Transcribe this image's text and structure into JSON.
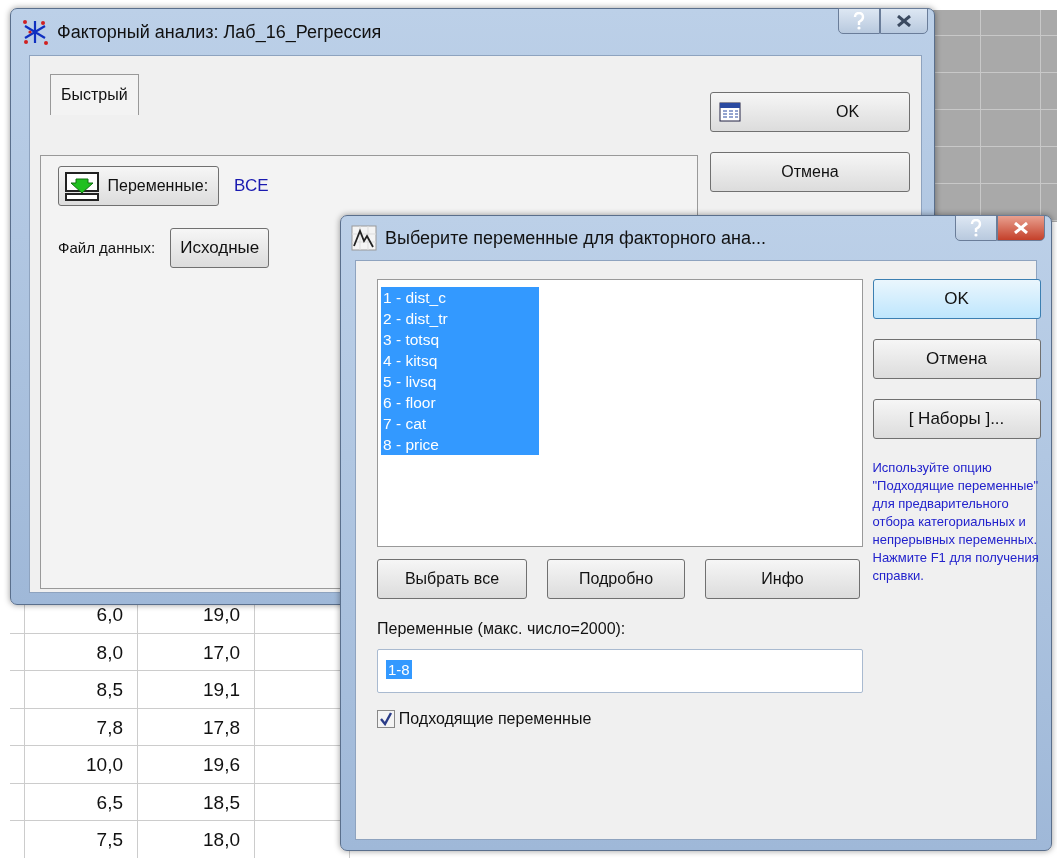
{
  "main_window": {
    "title": "Факторный анализ: Лаб_16_Регрессия",
    "tabs": [
      {
        "label": "Быстрый",
        "selected": true
      }
    ],
    "variables_button": "Переменные:",
    "variables_value": "ВСЕ",
    "data_file_label": "Файл данных:",
    "data_file_button": "Исходные",
    "buttons": [
      "OK",
      "Отмена"
    ]
  },
  "spreadsheet": {
    "rows": [
      [
        "6,0",
        "19,0"
      ],
      [
        "8,0",
        "17,0"
      ],
      [
        "8,5",
        "19,1"
      ],
      [
        "7,8",
        "17,8"
      ],
      [
        "10,0",
        "19,6"
      ],
      [
        "6,5",
        "18,5"
      ],
      [
        "7,5",
        "18,0"
      ]
    ]
  },
  "dialog": {
    "title": "Выберите переменные для факторного ана...",
    "variables": [
      {
        "label": "1 - dist_c",
        "selected": true
      },
      {
        "label": "2 - dist_tr",
        "selected": true
      },
      {
        "label": "3 - totsq",
        "selected": true
      },
      {
        "label": "4 - kitsq",
        "selected": true
      },
      {
        "label": "5 - livsq",
        "selected": true
      },
      {
        "label": "6 - floor",
        "selected": true
      },
      {
        "label": "7 - cat",
        "selected": true
      },
      {
        "label": "8 - price",
        "selected": true
      }
    ],
    "side_buttons": [
      "OK",
      "Отмена",
      "[ Наборы ]..."
    ],
    "help_text": "Используйте опцию \"Подходящие переменные\" для предварительного отбора категориальных и непрерывных переменных. Нажмите F1 для получения справки.",
    "list_buttons": [
      "Выбрать все",
      "Подробно",
      "Инфо"
    ],
    "field_label": "Переменные (макс. число=2000):",
    "field_value": "1-8",
    "checkbox": {
      "label": "Подходящие переменные",
      "checked": true
    }
  }
}
